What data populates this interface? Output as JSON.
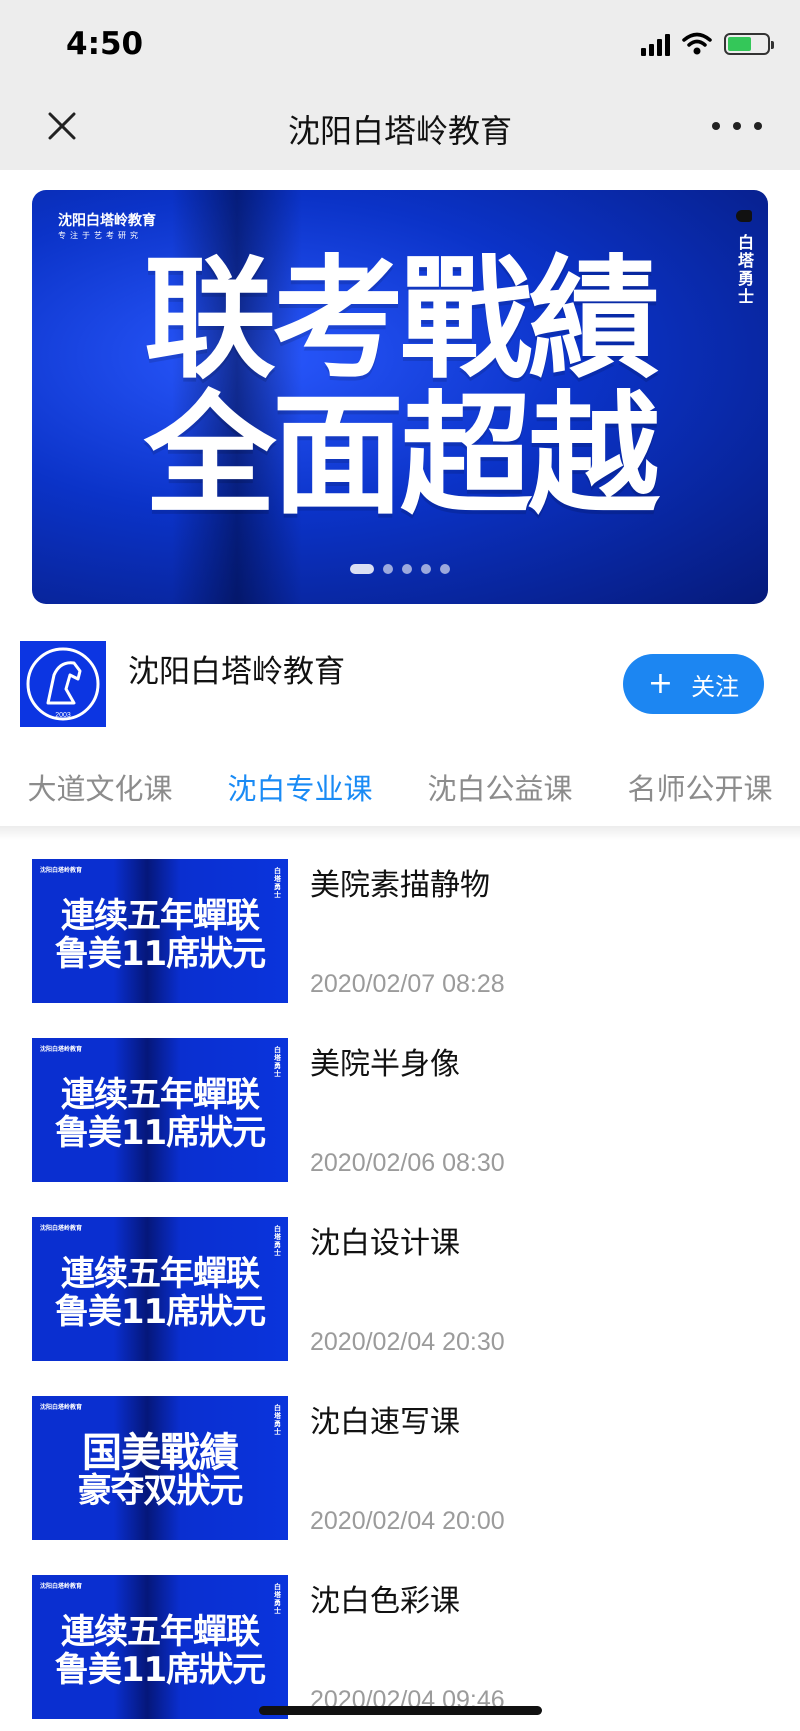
{
  "status_bar": {
    "time": "4:50"
  },
  "nav": {
    "title": "沈阳白塔岭教育"
  },
  "banner": {
    "brand": "沈阳白塔岭教育",
    "brand_sub": "专注于艺考研究",
    "side_text": "白塔勇士",
    "headline_line1": "联考戰績",
    "headline_line2": "全面超越",
    "slides_total": 5,
    "active_slide": 1
  },
  "profile": {
    "name": "沈阳白塔岭教育",
    "logo_year": "2003",
    "follow_label": "关注",
    "follow_icon": "+"
  },
  "tabs": [
    {
      "label": "大道文化课",
      "active": false
    },
    {
      "label": "沈白专业课",
      "active": true
    },
    {
      "label": "沈白公益课",
      "active": false
    },
    {
      "label": "名师公开课",
      "active": false
    }
  ],
  "articles": [
    {
      "title": "美院素描静物",
      "date": "2020/02/07 08:28",
      "thumb_line1": "連续五年蟬联",
      "thumb_line2": "鲁美11席狀元"
    },
    {
      "title": "美院半身像",
      "date": "2020/02/06 08:30",
      "thumb_line1": "連续五年蟬联",
      "thumb_line2": "鲁美11席狀元"
    },
    {
      "title": "沈白设计课",
      "date": "2020/02/04 20:30",
      "thumb_line1": "連续五年蟬联",
      "thumb_line2": "鲁美11席狀元"
    },
    {
      "title": "沈白速写课",
      "date": "2020/02/04 20:00",
      "thumb_line1": "国美戰績",
      "thumb_line2": "豪夺双狀元"
    },
    {
      "title": "沈白色彩课",
      "date": "2020/02/04 09:46",
      "thumb_line1": "連续五年蟬联",
      "thumb_line2": "鲁美11席狀元"
    }
  ],
  "thumb_brand": "沈阳白塔岭教育",
  "thumb_side": "白塔勇士",
  "colors": {
    "accent": "#1a8bf5",
    "follow_button": "#1c86f2",
    "banner_blue": "#0b33c8"
  },
  "icons": {
    "close": "close-icon",
    "more": "more-icon",
    "signal": "signal-icon",
    "wifi": "wifi-icon",
    "battery": "battery-icon"
  }
}
